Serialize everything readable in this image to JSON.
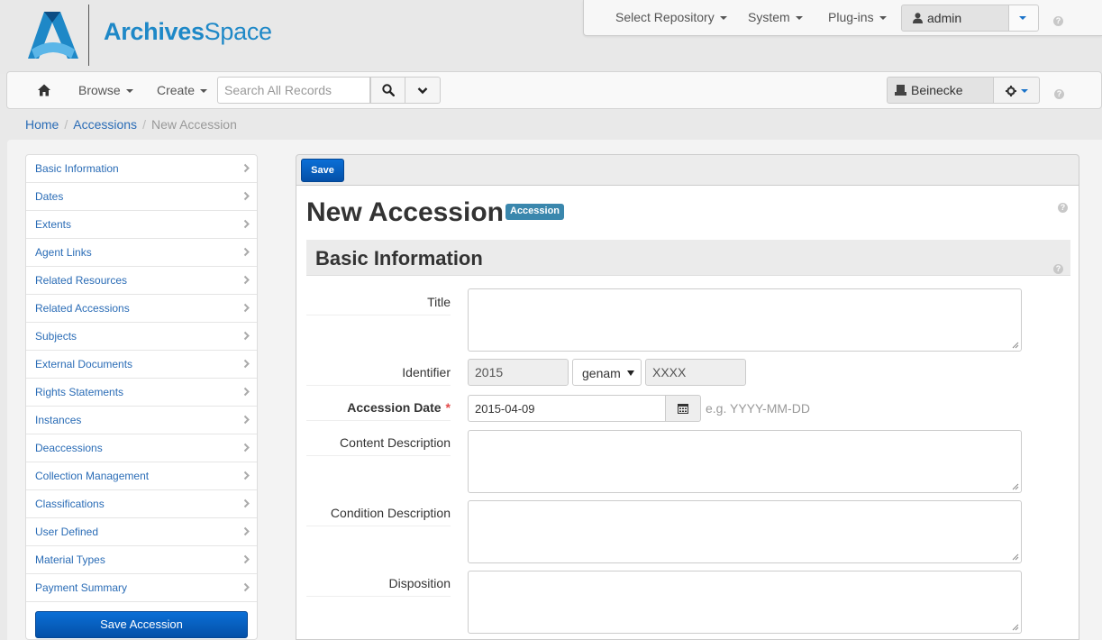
{
  "brand": {
    "name_bold": "Archives",
    "name_light": "Space",
    "colors": {
      "blue": "#1e88c7",
      "dark_blue": "#0d4d84"
    }
  },
  "top_menu": {
    "select_repository": "Select Repository",
    "system": "System",
    "plugins": "Plug-ins",
    "user": "admin",
    "help": "?"
  },
  "navbar": {
    "browse": "Browse",
    "create": "Create",
    "search_placeholder": "Search All Records",
    "repository": "Beinecke",
    "help": "?"
  },
  "breadcrumb": {
    "home": "Home",
    "accessions": "Accessions",
    "current": "New Accession",
    "sep": "/"
  },
  "sidebar": {
    "items": [
      {
        "label": "Basic Information"
      },
      {
        "label": "Dates"
      },
      {
        "label": "Extents"
      },
      {
        "label": "Agent Links"
      },
      {
        "label": "Related Resources"
      },
      {
        "label": "Related Accessions"
      },
      {
        "label": "Subjects"
      },
      {
        "label": "External Documents"
      },
      {
        "label": "Rights Statements"
      },
      {
        "label": "Instances"
      },
      {
        "label": "Deaccessions"
      },
      {
        "label": "Collection Management"
      },
      {
        "label": "Classifications"
      },
      {
        "label": "User Defined"
      },
      {
        "label": "Material Types"
      },
      {
        "label": "Payment Summary"
      }
    ],
    "save_button": "Save Accession"
  },
  "toolbar": {
    "save_label": "Save"
  },
  "form": {
    "title": "New Accession",
    "badge": "Accession",
    "help": "?",
    "section_title": "Basic Information",
    "section_help": "?",
    "fields": {
      "title": {
        "label": "Title",
        "value": ""
      },
      "identifier": {
        "label": "Identifier",
        "part1": "2015",
        "part2": "genam",
        "part3": "XXXX"
      },
      "accession_date": {
        "label": "Accession Date",
        "required_mark": "*",
        "value": "2015-04-09",
        "hint": "e.g. YYYY-MM-DD"
      },
      "content_description": {
        "label": "Content Description",
        "value": ""
      },
      "condition_description": {
        "label": "Condition Description",
        "value": ""
      },
      "disposition": {
        "label": "Disposition",
        "value": ""
      }
    }
  }
}
